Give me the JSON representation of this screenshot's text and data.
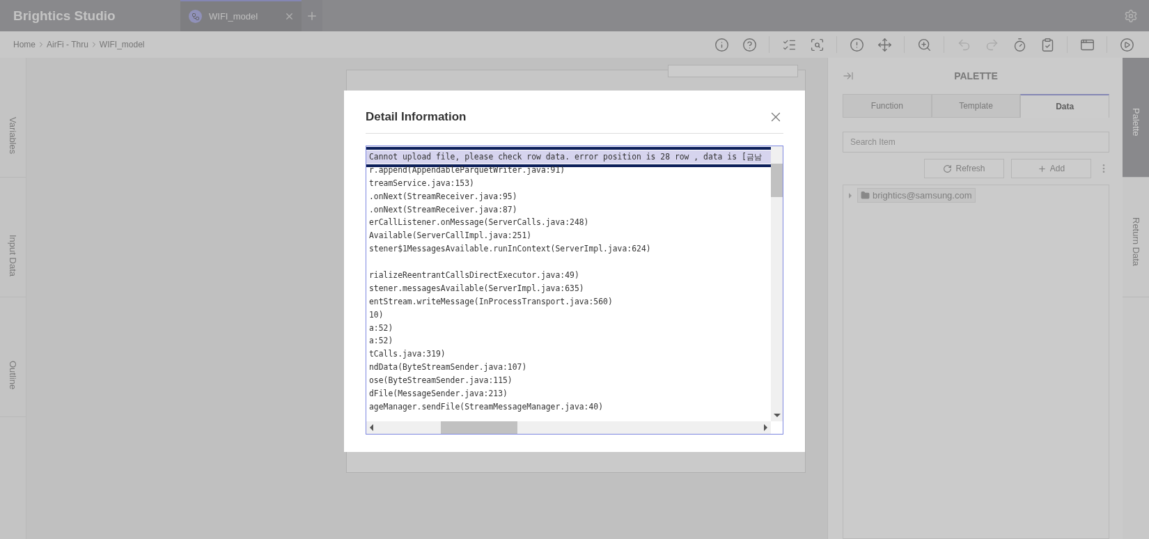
{
  "app": {
    "title": "Brightics Studio"
  },
  "tabs": [
    {
      "label": "WIFI_model",
      "selected": true
    }
  ],
  "breadcrumb": [
    "Home",
    "AirFi - Thru",
    "WIFI_model"
  ],
  "toolbar": [
    {
      "kind": "info",
      "disabled": false
    },
    {
      "kind": "help",
      "disabled": false
    },
    {
      "kind": "sep"
    },
    {
      "kind": "checklist",
      "disabled": false
    },
    {
      "kind": "copysearch",
      "disabled": false
    },
    {
      "kind": "sep"
    },
    {
      "kind": "alert",
      "disabled": false
    },
    {
      "kind": "move",
      "disabled": false
    },
    {
      "kind": "sep"
    },
    {
      "kind": "zoom",
      "disabled": false
    },
    {
      "kind": "sep"
    },
    {
      "kind": "undo",
      "disabled": true
    },
    {
      "kind": "redo",
      "disabled": true
    },
    {
      "kind": "timer",
      "disabled": false
    },
    {
      "kind": "clipboard",
      "disabled": false
    },
    {
      "kind": "sep"
    },
    {
      "kind": "variable",
      "disabled": false
    },
    {
      "kind": "sep"
    },
    {
      "kind": "run",
      "disabled": false
    }
  ],
  "left_tabs": [
    "Variables",
    "Input Data",
    "Outline"
  ],
  "right_tabs": [
    {
      "label": "Palette",
      "selected": true
    },
    {
      "label": "Return Data",
      "selected": false
    }
  ],
  "palette": {
    "title": "PALETTE",
    "tabs": [
      {
        "label": "Function",
        "selected": false
      },
      {
        "label": "Template",
        "selected": false
      },
      {
        "label": "Data",
        "selected": true
      }
    ],
    "search": {
      "placeholder": "Search Item"
    },
    "buttons": [
      {
        "kind": "refresh",
        "label": "Refresh"
      },
      {
        "kind": "add",
        "label": "Add"
      }
    ],
    "tree": [
      {
        "label": "brightics@samsung.com",
        "expanded": false
      }
    ]
  },
  "dialog": {
    "title": "Detail Information",
    "lines": [
      {
        "text": "Cannot upload file, please check row data. error position is 28 row , data is [금남",
        "selected": true
      },
      {
        "text": "r.append(AppendableParquetWriter.java:91)",
        "selected": false
      },
      {
        "text": "treamService.java:153)",
        "selected": false
      },
      {
        "text": ".onNext(StreamReceiver.java:95)",
        "selected": false
      },
      {
        "text": ".onNext(StreamReceiver.java:87)",
        "selected": false
      },
      {
        "text": "erCallListener.onMessage(ServerCalls.java:248)",
        "selected": false
      },
      {
        "text": "Available(ServerCallImpl.java:251)",
        "selected": false
      },
      {
        "text": "stener$1MessagesAvailable.runInContext(ServerImpl.java:624)",
        "selected": false
      },
      {
        "kind": "blank"
      },
      {
        "text": "rializeReentrantCallsDirectExecutor.java:49)",
        "selected": false
      },
      {
        "text": "stener.messagesAvailable(ServerImpl.java:635)",
        "selected": false
      },
      {
        "text": "entStream.writeMessage(InProcessTransport.java:560)",
        "selected": false
      },
      {
        "text": "10)",
        "selected": false
      },
      {
        "text": "a:52)",
        "selected": false
      },
      {
        "text": "a:52)",
        "selected": false
      },
      {
        "text": "tCalls.java:319)",
        "selected": false
      },
      {
        "text": "ndData(ByteStreamSender.java:107)",
        "selected": false
      },
      {
        "text": "ose(ByteStreamSender.java:115)",
        "selected": false
      },
      {
        "text": "dFile(MessageSender.java:213)",
        "selected": false
      },
      {
        "text": "ageManager.sendFile(StreamMessageManager.java:40)",
        "selected": false
      }
    ]
  }
}
